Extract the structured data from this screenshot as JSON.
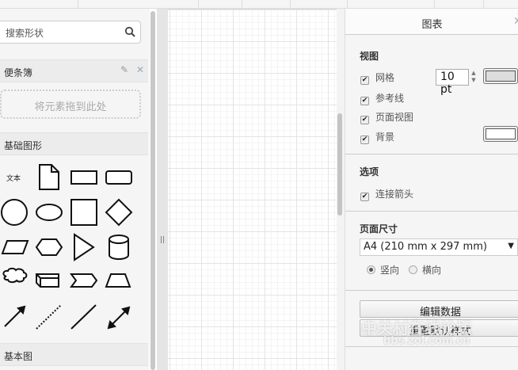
{
  "sidebar": {
    "search_placeholder": "搜索形状",
    "scratchpad": {
      "title": "便条簿",
      "drop_hint": "将元素拖到此处"
    },
    "sections": [
      "基础图形",
      "基本图"
    ],
    "text_shape_label": "文本"
  },
  "panel": {
    "title": "图表",
    "view": {
      "heading": "视图",
      "grid": {
        "label": "网格",
        "checked": true,
        "size": "10 pt",
        "color": "#dddddd"
      },
      "guides": {
        "label": "参考线",
        "checked": true
      },
      "page_view": {
        "label": "页面视图",
        "checked": true
      },
      "background": {
        "label": "背景",
        "checked": true,
        "color": "#ffffff"
      }
    },
    "options": {
      "heading": "选项",
      "connection_arrows": {
        "label": "连接箭头",
        "checked": true
      }
    },
    "page_size": {
      "heading": "页面尺寸",
      "selected": "A4 (210 mm x 297 mm)",
      "portrait": "竖向",
      "landscape": "横向",
      "orientation": "portrait"
    },
    "buttons": {
      "edit_data": "编辑数据",
      "reset_style": "重置默认样式"
    }
  },
  "watermark": {
    "name": "中关村在线论坛",
    "url": "bbs.zol.com.cn"
  }
}
